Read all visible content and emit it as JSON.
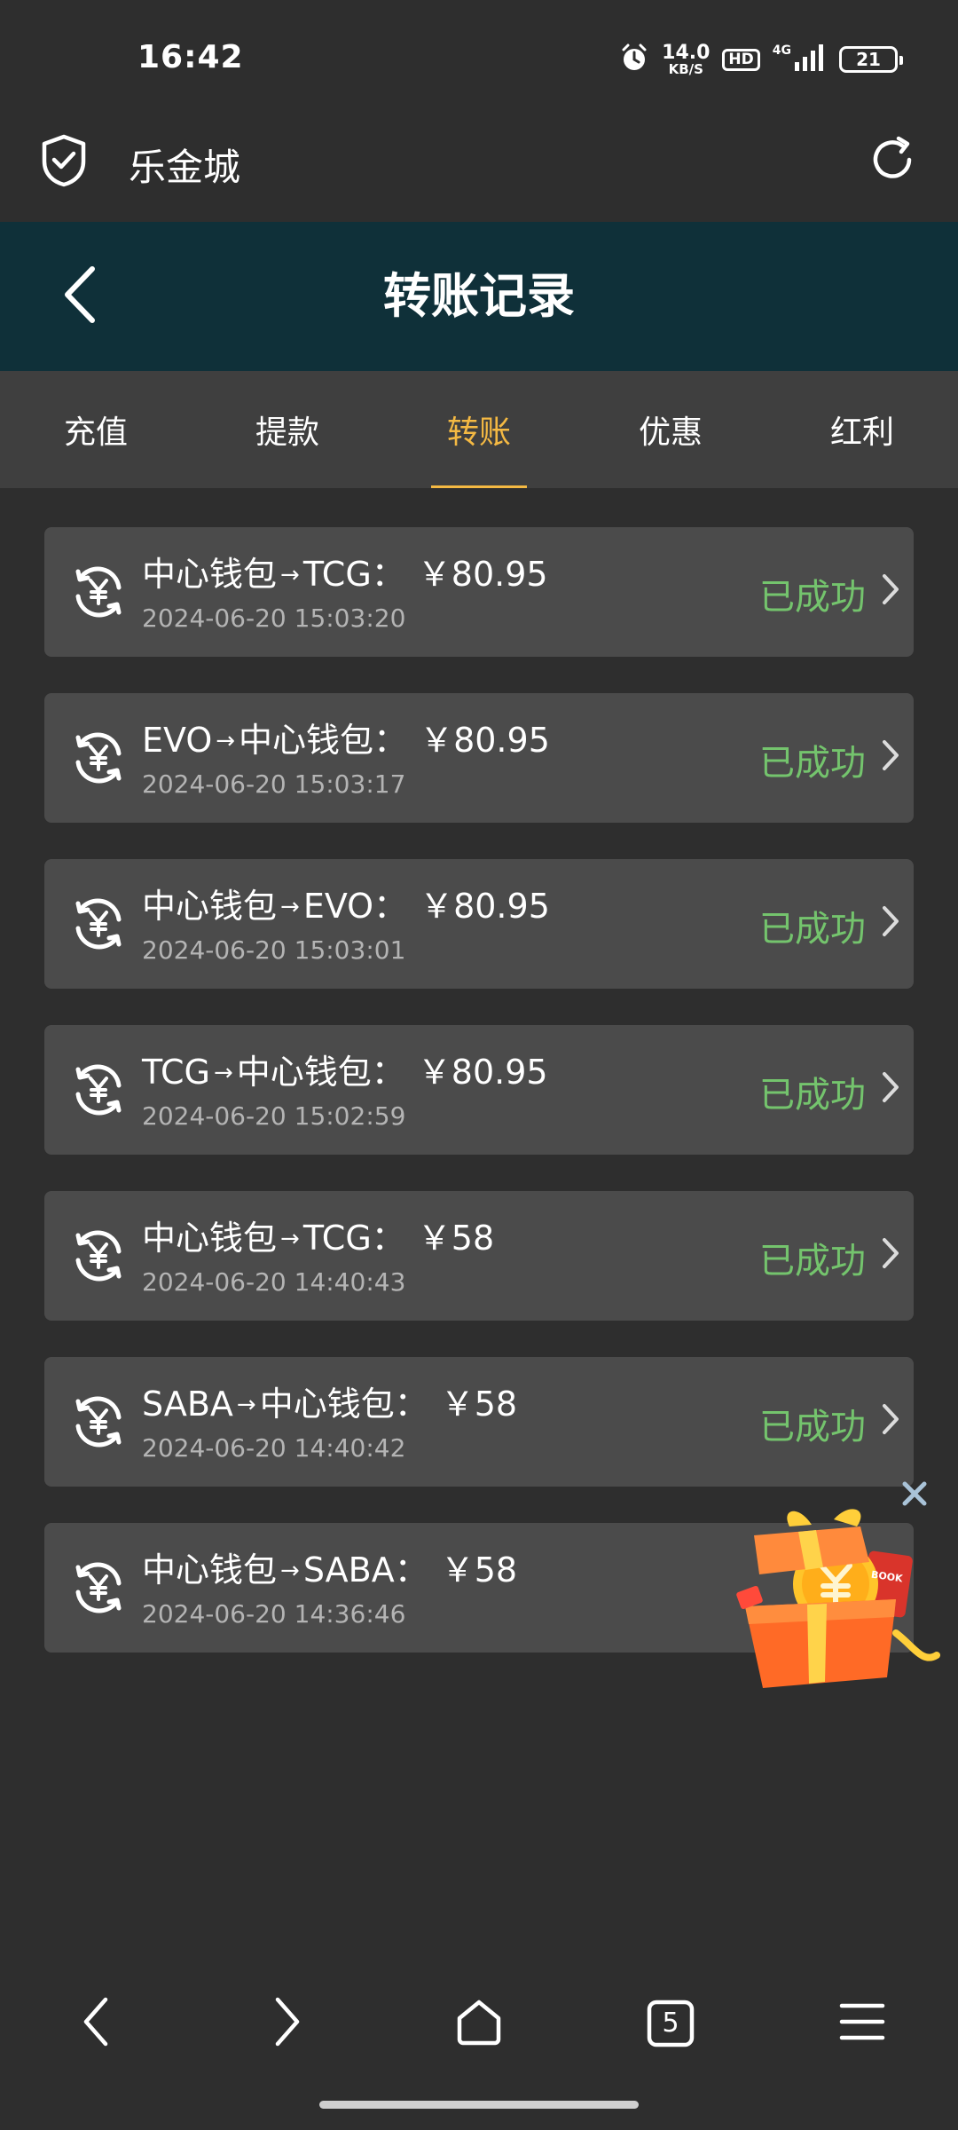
{
  "status_bar": {
    "time": "16:42",
    "net_speed_value": "14.0",
    "net_speed_unit": "KB/S",
    "hd": "HD",
    "network": "4G",
    "battery": "21",
    "icons": [
      "alarm-icon",
      "signal-icon",
      "battery-icon"
    ]
  },
  "browser": {
    "site_title": "乐金城",
    "icons": [
      "shield-check-icon",
      "reload-icon"
    ]
  },
  "header": {
    "title": "转账记录",
    "back_icon": "chevron-left-icon"
  },
  "tabs": [
    {
      "label": "充值",
      "active": false
    },
    {
      "label": "提款",
      "active": false
    },
    {
      "label": "转账",
      "active": true
    },
    {
      "label": "优惠",
      "active": false
    },
    {
      "label": "红利",
      "active": false
    }
  ],
  "transfers": [
    {
      "from": "中心钱包",
      "arrow": "→",
      "to": "TCG",
      "colon": "：",
      "amount": "￥80.95",
      "time": "2024-06-20 15:03:20",
      "status": "已成功"
    },
    {
      "from": "EVO",
      "arrow": "→",
      "to": "中心钱包",
      "colon": "：",
      "amount": "￥80.95",
      "time": "2024-06-20 15:03:17",
      "status": "已成功"
    },
    {
      "from": "中心钱包",
      "arrow": "→",
      "to": "EVO",
      "colon": "：",
      "amount": "￥80.95",
      "time": "2024-06-20 15:03:01",
      "status": "已成功"
    },
    {
      "from": "TCG",
      "arrow": "→",
      "to": "中心钱包",
      "colon": "：",
      "amount": "￥80.95",
      "time": "2024-06-20 15:02:59",
      "status": "已成功"
    },
    {
      "from": "中心钱包",
      "arrow": "→",
      "to": "TCG",
      "colon": "：",
      "amount": "￥58",
      "time": "2024-06-20 14:40:43",
      "status": "已成功"
    },
    {
      "from": "SABA",
      "arrow": "→",
      "to": "中心钱包",
      "colon": "：",
      "amount": "￥58",
      "time": "2024-06-20 14:40:42",
      "status": "已成功"
    },
    {
      "from": "中心钱包",
      "arrow": "→",
      "to": "SABA",
      "colon": "：",
      "amount": "￥58",
      "time": "2024-06-20 14:36:46",
      "status": ""
    }
  ],
  "floating_gift": {
    "label": "BOOK",
    "icons": [
      "close-icon",
      "gift-box-icon"
    ]
  },
  "bottom_nav": {
    "tab_count": "5",
    "icons": [
      "back-icon",
      "forward-icon",
      "home-icon",
      "tabs-icon",
      "menu-icon"
    ]
  },
  "colors": {
    "background": "#2e2e2e",
    "header": "#0f3039",
    "tabs_bar": "#3f3f3f",
    "card": "#4b4b4b",
    "active_tab": "#f4b943",
    "success": "#74c46d"
  }
}
